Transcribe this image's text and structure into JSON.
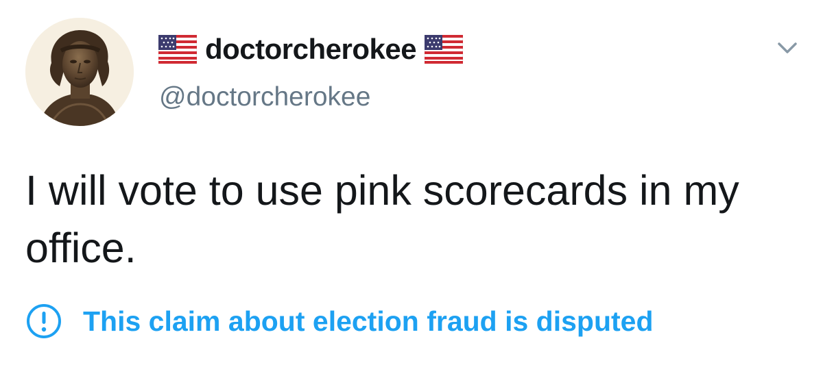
{
  "tweet": {
    "display_name": "doctorcherokee",
    "handle": "@doctorcherokee",
    "name_flags": [
      "us-flag-icon",
      "us-flag-icon"
    ],
    "text": "I will vote to use pink scorecards in my office.",
    "notice": {
      "icon": "exclamation-circle-icon",
      "text": "This claim about election fraud is disputed"
    },
    "menu_icon": "chevron-down-icon"
  },
  "colors": {
    "name": "#14171a",
    "handle": "#657786",
    "body_text": "#14171a",
    "notice": "#1da1f2",
    "background": "#ffffff"
  }
}
